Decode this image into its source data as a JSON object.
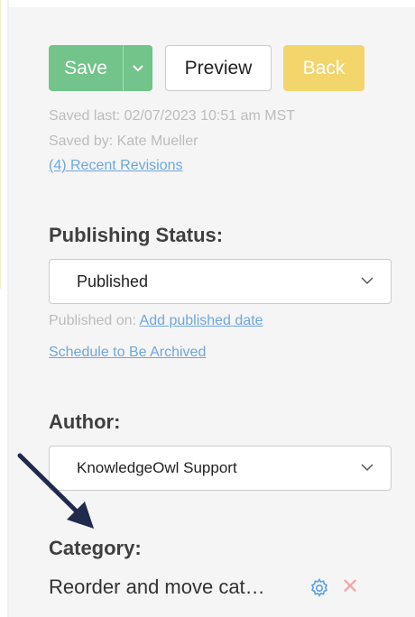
{
  "toolbar": {
    "save_label": "Save",
    "preview_label": "Preview",
    "back_label": "Back"
  },
  "revision_info": {
    "saved_last": "Saved last: 02/07/2023 10:51 am MST",
    "saved_by": "Saved by: Kate Mueller",
    "recent_revisions_link": "(4) Recent Revisions"
  },
  "publishing": {
    "title": "Publishing Status:",
    "status_value": "Published",
    "published_on_label": "Published on:",
    "add_date_link": "Add published date",
    "schedule_archive_link": "Schedule to Be Archived"
  },
  "author": {
    "title": "Author:",
    "value": "KnowledgeOwl Support"
  },
  "category": {
    "title": "Category:",
    "value": "Reorder and move cat…"
  },
  "icons": {
    "save_caret": "chevron-down-icon",
    "select_caret": "chevron-down-icon",
    "category_settings": "gear-icon",
    "category_remove": "close-icon",
    "annotation": "arrow-icon"
  },
  "colors": {
    "save": "#72c48a",
    "back": "#f2d56b",
    "link": "#6ea7e0",
    "arrow": "#1f2a4d",
    "remove": "#f3a6a6",
    "gear": "#5aa0e6"
  }
}
